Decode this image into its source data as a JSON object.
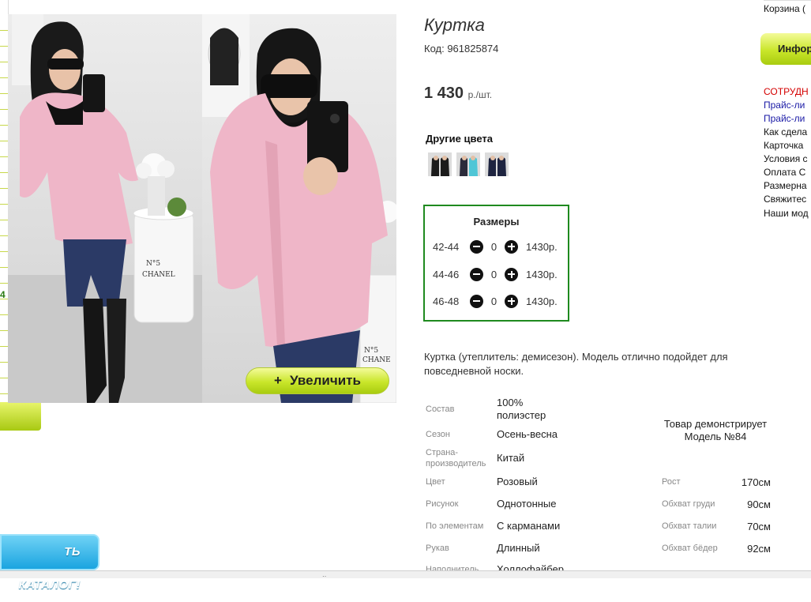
{
  "product": {
    "title": "Куртка",
    "code": "Код: 961825874",
    "price": "1 430",
    "price_unit": "р./шт.",
    "zoom_label": "Увеличить",
    "other_colors_label": "Другие цвета",
    "color_thumbs": [
      "black",
      "turquoise",
      "navy"
    ],
    "sizes": {
      "title": "Размеры",
      "rows": [
        {
          "size": "42-44",
          "qty": "0",
          "price": "1430р."
        },
        {
          "size": "44-46",
          "qty": "0",
          "price": "1430р."
        },
        {
          "size": "46-48",
          "qty": "0",
          "price": "1430р."
        }
      ]
    },
    "description": "Куртка (утеплитель: демисезон). Модель отлично подойдет для повседневной носки.",
    "properties": [
      {
        "label": "Состав",
        "value": "100% полиэстер"
      },
      {
        "label": "Сезон",
        "value": "Осень-весна"
      },
      {
        "label": "Страна-производитель",
        "value": "Китай"
      },
      {
        "label": "Цвет",
        "value": "Розовый"
      },
      {
        "label": "Рисунок",
        "value": "Однотонные"
      },
      {
        "label": "По элементам",
        "value": "С карманами"
      },
      {
        "label": "Рукав",
        "value": "Длинный"
      },
      {
        "label": "Наполнитель",
        "value": "Холлофайбер"
      }
    ],
    "model_note": "Товар демонстрирует Модель №84",
    "model_measures": [
      {
        "label": "Рост",
        "value": "170см"
      },
      {
        "label": "Обхват груди",
        "value": "90см"
      },
      {
        "label": "Обхват талии",
        "value": "70см"
      },
      {
        "label": "Обхват бёдер",
        "value": "92см"
      }
    ]
  },
  "sidebar": {
    "cart": "Корзина (",
    "info_button": "Инфор",
    "links": [
      {
        "label": "СОТРУДН",
        "color": "#d40000"
      },
      {
        "label": "Прайс-ли",
        "color": "#1a1aa6"
      },
      {
        "label": "Прайс-ли",
        "color": "#1a1aa6"
      },
      {
        "label": "Как сдела",
        "color": "#111111"
      },
      {
        "label": "Карточка",
        "color": "#111111"
      },
      {
        "label": "Условия с",
        "color": "#111111"
      },
      {
        "label": "Оплата С",
        "color": "#111111"
      },
      {
        "label": "Размерна",
        "color": "#111111"
      },
      {
        "label": "Свяжитес",
        "color": "#111111"
      },
      {
        "label": "Наши мод",
        "color": "#111111"
      }
    ]
  },
  "left": {
    "number": "4",
    "catalog_button": "ТЬ КАТАЛОГ!"
  },
  "colors": {
    "accent_green": "#c9e62a",
    "size_border": "#1f8a1f",
    "catalog_blue": "#1aa4e0",
    "jacket_pink": "#efb6c8"
  }
}
